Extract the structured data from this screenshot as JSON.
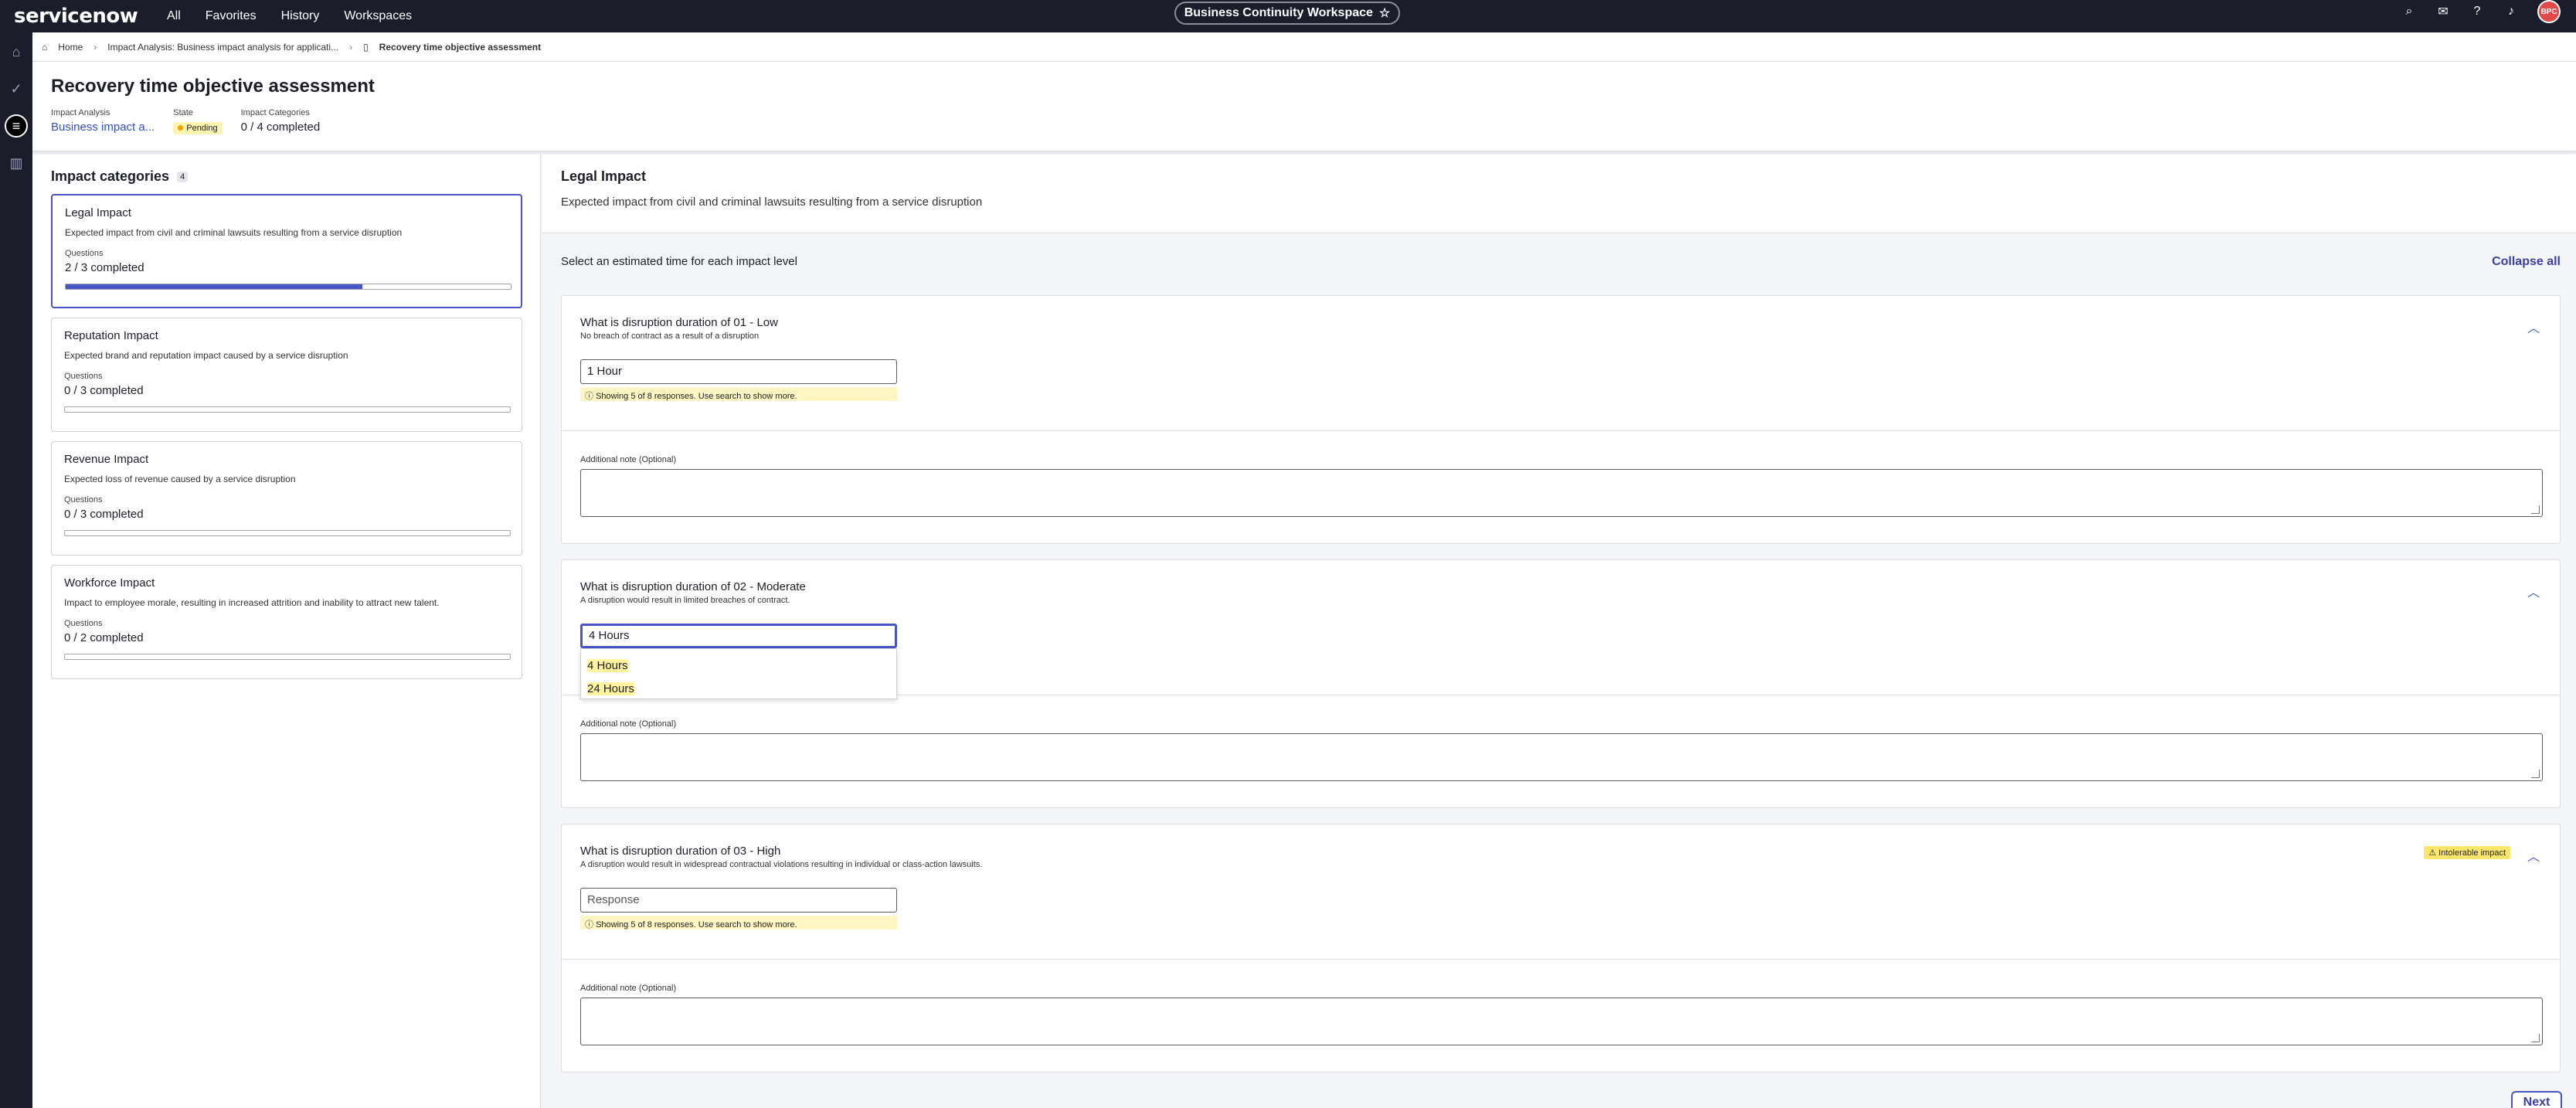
{
  "topbar": {
    "logo": "servicenow",
    "nav": [
      "All",
      "Favorites",
      "History",
      "Workspaces"
    ],
    "workspace_title": "Business Continuity Workspace",
    "star_icon": "★",
    "avatar_initials": "BPC"
  },
  "breadcrumb": {
    "home": "Home",
    "parent": "Impact Analysis: Business impact analysis for applicati...",
    "current": "Recovery time objective assessment"
  },
  "header": {
    "title": "Recovery time objective assessment",
    "fields": {
      "impact_analysis_label": "Impact Analysis",
      "impact_analysis_value": "Business impact a...",
      "state_label": "State",
      "state_value": "Pending",
      "categories_label": "Impact Categories",
      "categories_value": "0 / 4 completed"
    }
  },
  "left_panel": {
    "title": "Impact categories",
    "count": "4",
    "cards": [
      {
        "title": "Legal Impact",
        "desc": "Expected impact from civil and criminal lawsuits resulting from a service disruption",
        "q_label": "Questions",
        "q_value": "2 / 3 completed",
        "progress": 0.667
      },
      {
        "title": "Reputation Impact",
        "desc": "Expected brand and reputation impact caused by a service disruption",
        "q_label": "Questions",
        "q_value": "0 / 3 completed",
        "progress": 0
      },
      {
        "title": "Revenue Impact",
        "desc": "Expected loss of revenue caused by a service disruption",
        "q_label": "Questions",
        "q_value": "0 / 3 completed",
        "progress": 0
      },
      {
        "title": "Workforce Impact",
        "desc": "Impact to employee morale, resulting in increased attrition and inability to attract new talent.",
        "q_label": "Questions",
        "q_value": "0 / 2 completed",
        "progress": 0
      }
    ]
  },
  "right_panel": {
    "title": "Legal Impact",
    "subtitle": "Expected impact from civil and criminal lawsuits resulting from a service disruption",
    "instruction": "Select an estimated time for each impact level",
    "collapse_all": "Collapse all",
    "questions": [
      {
        "title": "What is disruption duration of 01 - Low",
        "desc": "No breach of contract as a result of a disruption",
        "value": "1 Hour",
        "hint": "Showing 5 of 8 responses. Use search to show more.",
        "note_label": "Additional note (Optional)"
      },
      {
        "title": "What is disruption duration of 02 - Moderate",
        "desc": "A disruption would result in limited breaches of contract.",
        "value": "4 Hours",
        "options": [
          "4 Hours",
          "24 Hours"
        ],
        "note_label": "Additional note (Optional)"
      },
      {
        "title": "What is disruption duration of 03 - High",
        "desc": "A disruption would result in widespread contractual violations resulting in individual or class-action lawsuits.",
        "placeholder": "Response",
        "badge": "Intolerable impact",
        "hint": "Showing 5 of 8 responses. Use search to show more.",
        "note_label": "Additional note (Optional)"
      }
    ],
    "next": "Next"
  },
  "colors": {
    "accent": "#4855c6",
    "topbar": "#1b1d2b",
    "warning": "#fde66b"
  }
}
